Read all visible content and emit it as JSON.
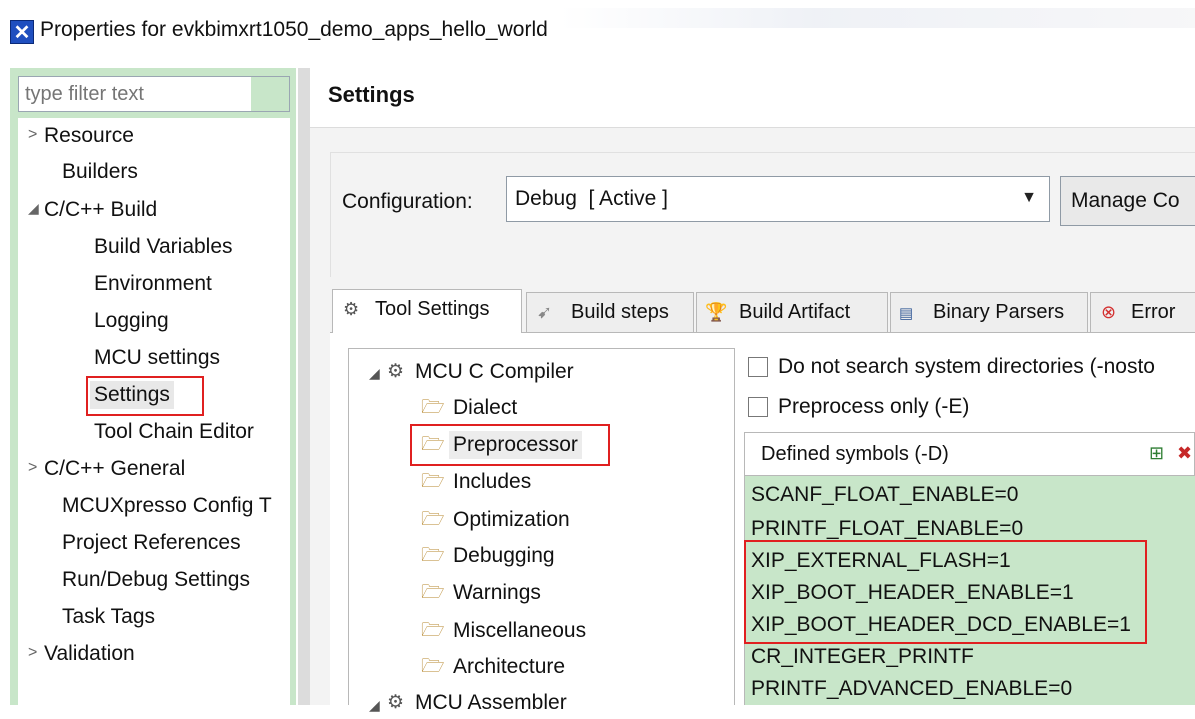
{
  "window": {
    "title": "Properties for evkbimxrt1050_demo_apps_hello_world",
    "icon": "x-app-icon"
  },
  "left_pane": {
    "filter_placeholder": "type filter text",
    "items": [
      {
        "label": "Resource",
        "twisty": ">"
      },
      {
        "label": "Builders",
        "twisty": ""
      },
      {
        "label": "C/C++ Build",
        "twisty": "◢"
      },
      {
        "label": "Build Variables",
        "twisty": ""
      },
      {
        "label": "Environment",
        "twisty": ""
      },
      {
        "label": "Logging",
        "twisty": ""
      },
      {
        "label": "MCU settings",
        "twisty": ""
      },
      {
        "label": "Settings",
        "twisty": "",
        "selected": true
      },
      {
        "label": "Tool Chain Editor",
        "twisty": ""
      },
      {
        "label": "C/C++ General",
        "twisty": ">"
      },
      {
        "label": "MCUXpresso Config T",
        "twisty": ""
      },
      {
        "label": "Project References",
        "twisty": ""
      },
      {
        "label": "Run/Debug Settings",
        "twisty": ""
      },
      {
        "label": "Task Tags",
        "twisty": ""
      },
      {
        "label": "Validation",
        "twisty": ">"
      }
    ]
  },
  "main": {
    "title": "Settings",
    "configuration_label": "Configuration:",
    "configuration_value": "Debug  [ Active ]",
    "manage_button": "Manage Co",
    "tabs": [
      {
        "label": "Tool Settings",
        "icon": "gear-icon",
        "active": true
      },
      {
        "label": "Build steps",
        "icon": "build-steps-icon"
      },
      {
        "label": "Build Artifact",
        "icon": "trophy-icon"
      },
      {
        "label": "Binary Parsers",
        "icon": "binary-icon"
      },
      {
        "label": "Error",
        "icon": "error-icon"
      }
    ],
    "tool_tree": [
      {
        "label": "MCU C Compiler",
        "type": "tool",
        "twisty": "◢"
      },
      {
        "label": "Dialect",
        "type": "category"
      },
      {
        "label": "Preprocessor",
        "type": "category",
        "selected": true
      },
      {
        "label": "Includes",
        "type": "category"
      },
      {
        "label": "Optimization",
        "type": "category"
      },
      {
        "label": "Debugging",
        "type": "category"
      },
      {
        "label": "Warnings",
        "type": "category"
      },
      {
        "label": "Miscellaneous",
        "type": "category"
      },
      {
        "label": "Architecture",
        "type": "category"
      },
      {
        "label": "MCU Assembler",
        "type": "tool",
        "twisty": "◢"
      }
    ],
    "options": {
      "nostdinc_label": "Do not search system directories (-nosto",
      "preprocess_only_label": "Preprocess only (-E)",
      "defined_symbols_title": "Defined symbols (-D)",
      "defined_symbols": [
        "SCANF_FLOAT_ENABLE=0",
        "PRINTF_FLOAT_ENABLE=0",
        "XIP_EXTERNAL_FLASH=1",
        "XIP_BOOT_HEADER_ENABLE=1",
        "XIP_BOOT_HEADER_DCD_ENABLE=1",
        "CR_INTEGER_PRINTF",
        "PRINTF_ADVANCED_ENABLE=0"
      ]
    }
  },
  "colors": {
    "highlight_green": "#c8e6c9",
    "annotation_red": "#e02020"
  }
}
